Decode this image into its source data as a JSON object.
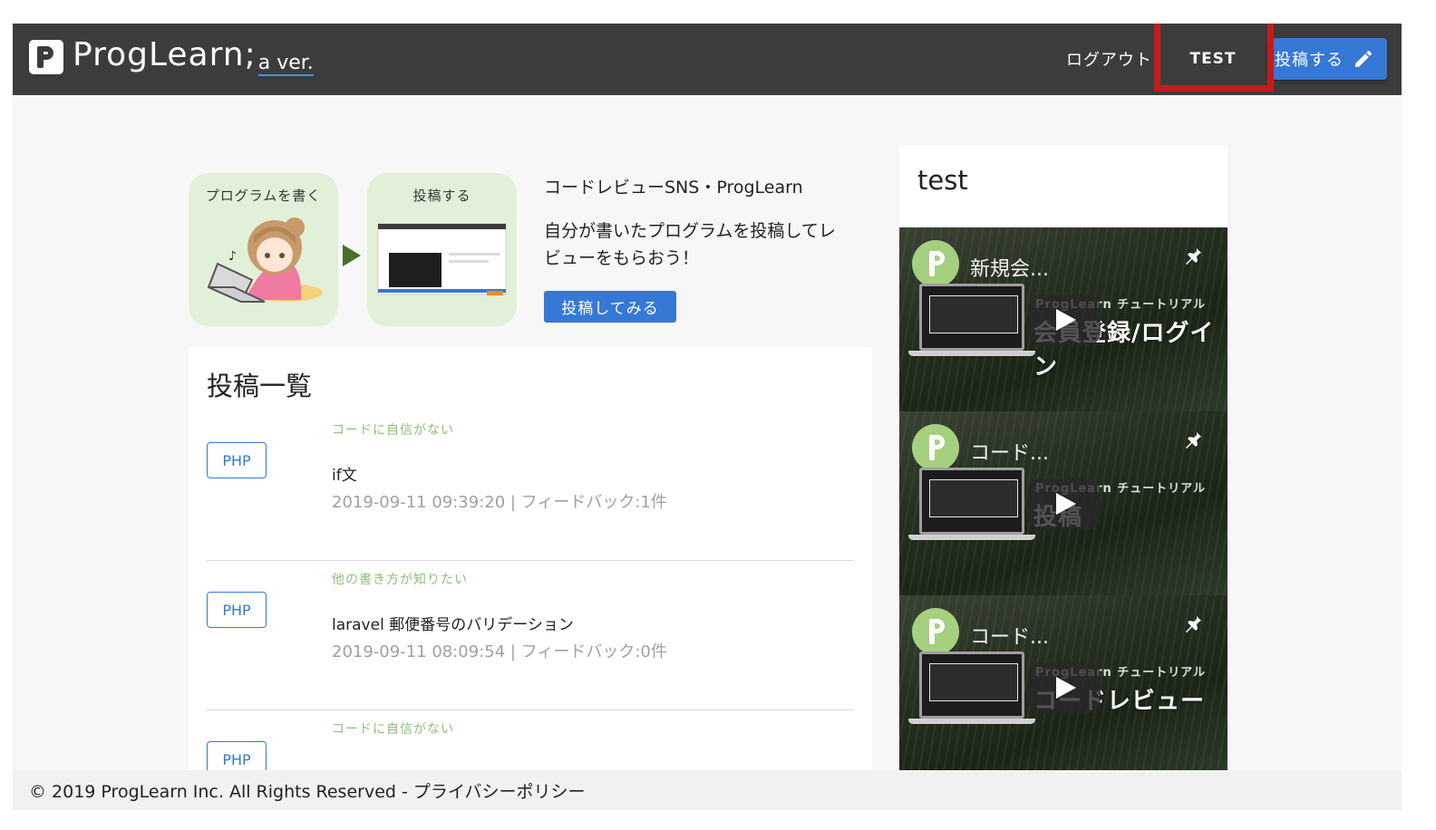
{
  "header": {
    "logo_text": "ProgLearn;",
    "logo_version": "a ver.",
    "logout_label": "ログアウト",
    "user_label": "TEST",
    "post_button_label": "投稿する"
  },
  "hero": {
    "step1_label": "プログラムを書く",
    "step2_label": "投稿する",
    "title": "コードレビューSNS・ProgLearn",
    "description": "自分が書いたプログラムを投稿してレビューをもらおう！",
    "cta_label": "投稿してみる"
  },
  "post_list": {
    "heading": "投稿一覧",
    "posts": [
      {
        "language": "PHP",
        "tag": "コードに自信がない",
        "title": "if文",
        "meta": "2019-09-11 09:39:20 | フィードバック:1件"
      },
      {
        "language": "PHP",
        "tag": "他の書き方が知りたい",
        "title": "laravel 郵便番号のバリデーション",
        "meta": "2019-09-11 08:09:54 | フィードバック:0件"
      },
      {
        "language": "PHP",
        "tag": "コードに自信がない",
        "title": "",
        "meta": ""
      }
    ]
  },
  "sidebar": {
    "title": "test",
    "videos": [
      {
        "title": "新規会...",
        "overlay_label": "ProgLearn チュートリアル",
        "overlay_main": "会員登録/ログイン"
      },
      {
        "title": "コード...",
        "overlay_label": "ProgLearn チュートリアル",
        "overlay_main": "投稿"
      },
      {
        "title": "コード...",
        "overlay_label": "ProgLearn チュートリアル",
        "overlay_main": "コードレビュー"
      }
    ]
  },
  "footer": {
    "copyright": "© 2019 ProgLearn Inc. All Rights Reserved - プライバシーポリシー"
  },
  "colors": {
    "header_bg": "#3c3c3c",
    "accent": "#3578d6",
    "highlight": "#c41b1b",
    "hero_card_bg": "#e3f0d9",
    "tag_green": "#8cc07a"
  }
}
